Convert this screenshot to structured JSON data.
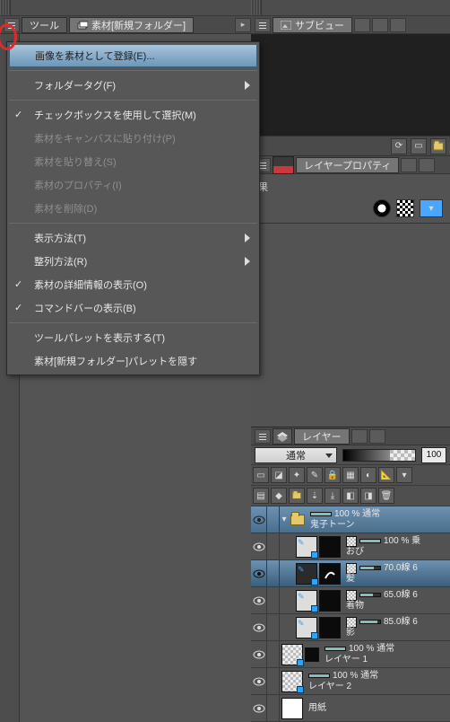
{
  "left": {
    "tabs": {
      "tool": "ツール",
      "material": "素材[新規フォルダー]"
    }
  },
  "right": {
    "subview_label": "サブビュー",
    "layer_property_label": "レイヤープロパティ",
    "effect_label": "果",
    "layers_label": "レイヤー"
  },
  "ctx": {
    "register_image": "画像を素材として登録(E)...",
    "folder_tag": "フォルダータグ(F)",
    "use_checkbox": "チェックボックスを使用して選択(M)",
    "paste_to_canvas": "素材をキャンバスに貼り付け(P)",
    "replace_material": "素材を貼り替え(S)",
    "material_property": "素材のプロパティ(I)",
    "delete_material": "素材を削除(D)",
    "display_method": "表示方法(T)",
    "sort_method": "整列方法(R)",
    "show_detail": "素材の詳細情報の表示(O)",
    "show_commandbar": "コマンドバーの表示(B)",
    "show_tool_palette": "ツールパレットを表示する(T)",
    "hide_material_palette": "素材[新規フォルダー]パレットを隠す"
  },
  "layers": {
    "mode": "通常",
    "opacity": "100",
    "folder": {
      "line1": "100 % 通常",
      "line2": "鬼子トーン"
    },
    "items": [
      {
        "line1": "100 % 乗",
        "line2": "おび"
      },
      {
        "line1": "70.0線 6",
        "line2": "髪"
      },
      {
        "line1": "65.0線 6",
        "line2": "着物"
      },
      {
        "line1": "85.0線 6",
        "line2": "影"
      }
    ],
    "lower": [
      {
        "line1": "100 % 通常",
        "line2": "レイヤー 1"
      },
      {
        "line1": "100 % 通常",
        "line2": "レイヤー 2"
      },
      {
        "line1": "",
        "line2": "用紙"
      }
    ]
  }
}
